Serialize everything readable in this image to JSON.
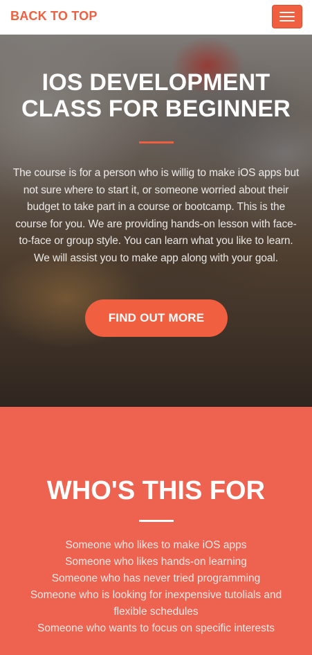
{
  "navbar": {
    "brand_label": "BACK TO TOP",
    "menu_icon": "hamburger-menu-icon",
    "accent_color": "#f05f40"
  },
  "hero": {
    "title": "iOS DEVELOPMENT CLASS FOR BEGINNER",
    "description": "The course is for a person who is willig to make iOS apps but not sure where to start it, or someone worried about their budget to take part in a course or bootcamp. This is the course for you. We are providing hands-on lesson with face-to-face or group style. You can learn what you like to learn. We will assist you to make app along with your goal.",
    "button_label": "FIND OUT MORE"
  },
  "who": {
    "title": "WHO'S THIS FOR",
    "items": [
      "Someone who likes to make iOS apps",
      "Someone who likes hands-on learning",
      "Someone who has never tried programming",
      "Someone who is looking for inexpensive tutolials and flexible schedules",
      "Someone who wants to focus on specific interests"
    ],
    "background_color": "#ed6350"
  }
}
